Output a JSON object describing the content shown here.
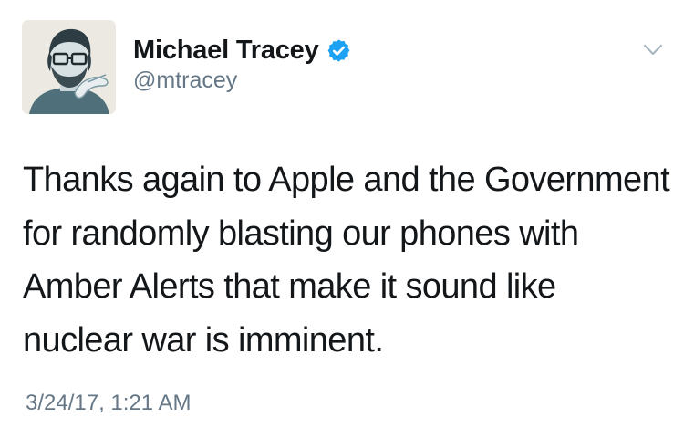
{
  "author": {
    "display_name": "Michael Tracey",
    "handle": "@mtracey",
    "verified": true,
    "avatar_icon": "profile-illustration"
  },
  "tweet": {
    "text": "Thanks again to Apple and the Government for randomly blasting our phones with Amber Alerts that make it sound like nuclear war is imminent.",
    "timestamp": "3/24/17, 1:21 AM"
  },
  "icons": {
    "verified_badge": "verified-badge-icon",
    "menu_caret": "chevron-down-icon"
  },
  "colors": {
    "name_text": "#14171a",
    "secondary_text": "#657786",
    "verified_blue": "#1da1f2",
    "caret_gray": "#aab8c2"
  }
}
